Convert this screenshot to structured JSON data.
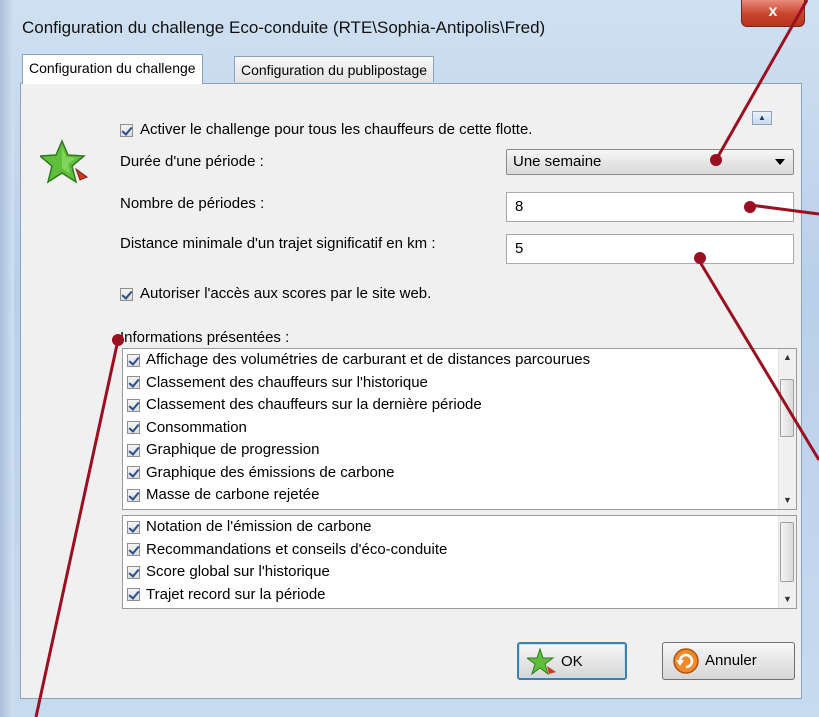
{
  "window": {
    "title": "Configuration du challenge Eco-conduite (RTE\\Sophia-Antipolis\\Fred)",
    "close_label": "x"
  },
  "tabs": [
    {
      "label": "Configuration du challenge",
      "active": true
    },
    {
      "label": "Configuration du publipostage",
      "active": false
    }
  ],
  "form": {
    "activate_label": "Activer le challenge pour tous les chauffeurs de cette flotte.",
    "activate_checked": true,
    "period_duration_label": "Durée d'une période :",
    "period_duration_value": "Une semaine",
    "period_count_label": "Nombre de périodes :",
    "period_count_value": "8",
    "min_distance_label": "Distance minimale d'un trajet significatif en km :",
    "min_distance_value": "5",
    "web_access_label": "Autoriser l'accès aux scores par le site web.",
    "web_access_checked": true
  },
  "info_section": {
    "label": "Informations présentées :",
    "list_top": [
      {
        "label": "Affichage des volumétries de carburant et de distances parcourues",
        "checked": true
      },
      {
        "label": "Classement des chauffeurs sur l'historique",
        "checked": true
      },
      {
        "label": "Classement des chauffeurs sur la dernière période",
        "checked": true
      },
      {
        "label": "Consommation",
        "checked": true
      },
      {
        "label": "Graphique de progression",
        "checked": true
      },
      {
        "label": "Graphique des émissions de carbone",
        "checked": true
      },
      {
        "label": "Masse de carbone rejetée",
        "checked": true
      }
    ],
    "list_bottom": [
      {
        "label": "Notation de l'émission de carbone",
        "checked": true
      },
      {
        "label": "Recommandations et conseils d'éco-conduite",
        "checked": true
      },
      {
        "label": "Score global sur l'historique",
        "checked": true
      },
      {
        "label": "Trajet record sur la période",
        "checked": true
      }
    ]
  },
  "buttons": {
    "ok_label": "OK",
    "cancel_label": "Annuler"
  },
  "colors": {
    "annotation": "#9b1020",
    "accent_border": "#3c7fb1"
  },
  "icons": [
    "star-icon",
    "chevron-down-icon",
    "spin-up-icon",
    "ok-star-icon",
    "cancel-undo-icon"
  ]
}
